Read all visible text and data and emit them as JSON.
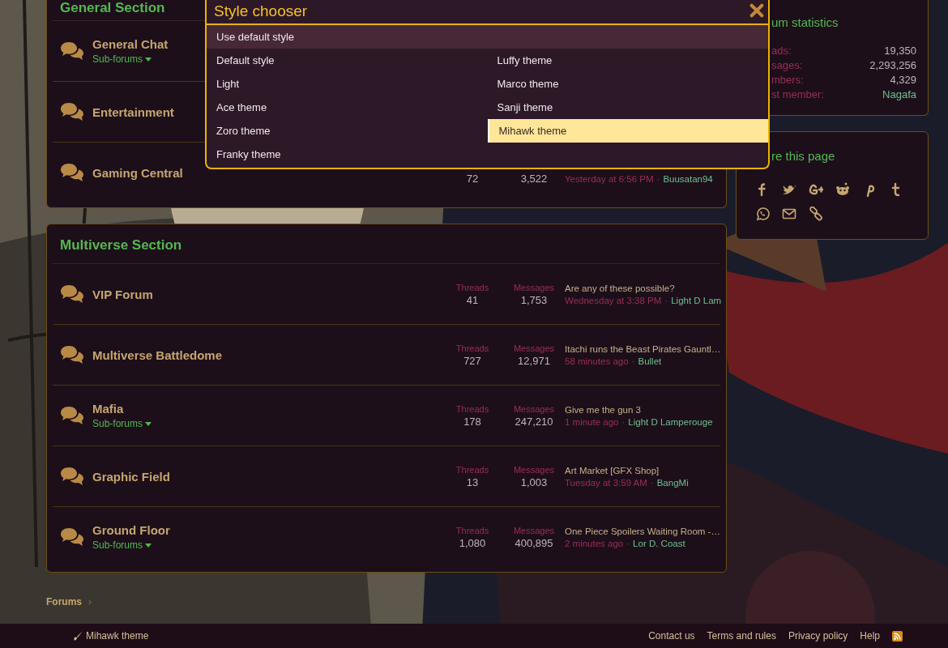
{
  "sections": [
    {
      "title": "General Section",
      "forums": [
        {
          "title": "General Chat",
          "subforums": "Sub-forums"
        },
        {
          "title": "Entertainment"
        },
        {
          "title": "Gaming Central",
          "stats": {
            "threads": "72",
            "messages": "3,522",
            "separator": "·",
            "latest_time": "Yesterday at 6:56 PM",
            "latest_user": "Buusatan94"
          }
        }
      ]
    },
    {
      "title": "Multiverse Section",
      "forums": [
        {
          "title": "VIP Forum",
          "stats": {
            "threads_label": "Threads",
            "threads": "41",
            "messages_label": "Messages",
            "messages": "1,753",
            "latest_title": "Are any of these possible?",
            "separator": "·",
            "latest_time": "Wednesday at 3:38 PM",
            "latest_user": "Light D Lam"
          }
        },
        {
          "title": "Multiverse Battledome",
          "stats": {
            "threads_label": "Threads",
            "threads": "727",
            "messages_label": "Messages",
            "messages": "12,971",
            "latest_title": "Itachi runs the Beast Pirates Gauntl…",
            "separator": "·",
            "latest_time": "58 minutes ago",
            "latest_user": "Bullet"
          }
        },
        {
          "title": "Mafia",
          "subforums": "Sub-forums",
          "stats": {
            "threads_label": "Threads",
            "threads": "178",
            "messages_label": "Messages",
            "messages": "247,210",
            "latest_title": "Give me the gun 3",
            "separator": "·",
            "latest_time": "1 minute ago",
            "latest_user": "Light D Lamperouge"
          }
        },
        {
          "title": "Graphic Field",
          "stats": {
            "threads_label": "Threads",
            "threads": "13",
            "messages_label": "Messages",
            "messages": "1,003",
            "latest_title": "Art Market [GFX Shop]",
            "separator": "·",
            "latest_time": "Tuesday at 3:59 AM",
            "latest_user": "BangMi"
          }
        },
        {
          "title": "Ground Floor",
          "subforums": "Sub-forums",
          "stats": {
            "threads_label": "Threads",
            "threads": "1,080",
            "messages_label": "Messages",
            "messages": "400,895",
            "latest_title": "One Piece Spoilers Waiting Room -…",
            "separator": "·",
            "latest_time": "2 minutes ago",
            "latest_user": "Lor D. Coast"
          }
        }
      ]
    }
  ],
  "sidebar": {
    "stats": {
      "title": "um statistics",
      "rows": [
        {
          "label": "ads:",
          "value": "19,350",
          "kind": "number"
        },
        {
          "label": "sages:",
          "value": "2,293,256",
          "kind": "number"
        },
        {
          "label": "mbers:",
          "value": "4,329",
          "kind": "number"
        },
        {
          "label": "st member:",
          "value": "Nagafa",
          "kind": "user"
        }
      ]
    },
    "share": {
      "title": "re this page"
    }
  },
  "style_chooser": {
    "title": "Style chooser",
    "default_option": {
      "label": "Use default style",
      "highlighted": true
    },
    "columns": [
      {
        "items": [
          {
            "label": "Default style",
            "selected": false
          },
          {
            "label": "Light",
            "selected": false
          },
          {
            "label": "Ace theme",
            "selected": false
          },
          {
            "label": "Zoro theme",
            "selected": false
          },
          {
            "label": "Franky theme",
            "selected": false
          }
        ]
      },
      {
        "items": [
          {
            "label": "Luffy theme",
            "selected": false
          },
          {
            "label": "Marco theme",
            "selected": false
          },
          {
            "label": "Sanji theme",
            "selected": false
          },
          {
            "label": "Mihawk theme",
            "selected": true
          }
        ]
      }
    ]
  },
  "breadcrumb": {
    "items": [
      "Forums"
    ],
    "separator": "›"
  },
  "footer": {
    "style_link": "Mihawk theme",
    "links": [
      "Contact us",
      "Terms and rules",
      "Privacy policy",
      "Help"
    ]
  }
}
